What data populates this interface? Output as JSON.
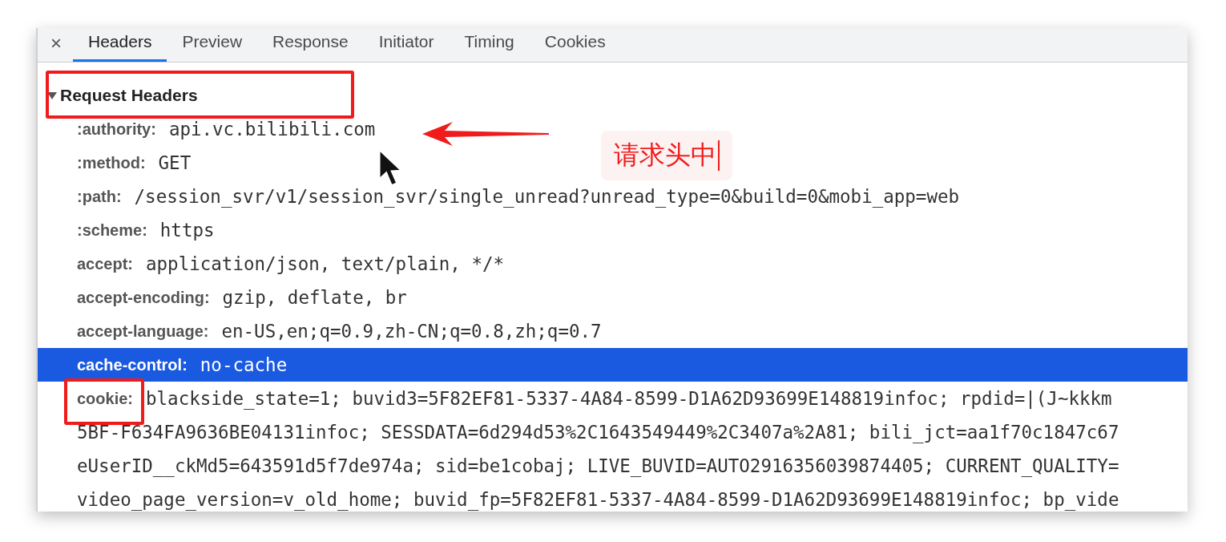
{
  "tabs": [
    {
      "label": "Headers",
      "selected": true
    },
    {
      "label": "Preview",
      "selected": false
    },
    {
      "label": "Response",
      "selected": false
    },
    {
      "label": "Initiator",
      "selected": false
    },
    {
      "label": "Timing",
      "selected": false
    },
    {
      "label": "Cookies",
      "selected": false
    }
  ],
  "close": "×",
  "section": {
    "title": "Request Headers",
    "expanded": true
  },
  "headers": [
    {
      "name": ":authority:",
      "value": "api.vc.bilibili.com",
      "selected": false
    },
    {
      "name": ":method:",
      "value": "GET",
      "selected": false
    },
    {
      "name": ":path:",
      "value": "/session_svr/v1/session_svr/single_unread?unread_type=0&build=0&mobi_app=web",
      "selected": false
    },
    {
      "name": ":scheme:",
      "value": "https",
      "selected": false
    },
    {
      "name": "accept:",
      "value": "application/json, text/plain, */*",
      "selected": false
    },
    {
      "name": "accept-encoding:",
      "value": "gzip, deflate, br",
      "selected": false
    },
    {
      "name": "accept-language:",
      "value": "en-US,en;q=0.9,zh-CN;q=0.8,zh;q=0.7",
      "selected": false
    },
    {
      "name": "cache-control:",
      "value": "no-cache",
      "selected": true
    },
    {
      "name": "cookie:",
      "value": "blackside_state=1; buvid3=5F82EF81-5337-4A84-8599-D1A62D93699E148819infoc; rpdid=|(J~kkkm",
      "selected": false
    }
  ],
  "cookie_continuation": [
    "5BF-F634FA9636BE04131infoc; SESSDATA=6d294d53%2C1643549449%2C3407a%2A81; bili_jct=aa1f70c1847c67",
    "eUserID__ckMd5=643591d5f7de974a; sid=be1cobaj; LIVE_BUVID=AUTO2916356039874405; CURRENT_QUALITY=",
    "video_page_version=v_old_home; buvid_fp=5F82EF81-5337-4A84-8599-D1A62D93699E148819infoc; bp_vide"
  ],
  "annotation": {
    "text": "请求头中"
  }
}
